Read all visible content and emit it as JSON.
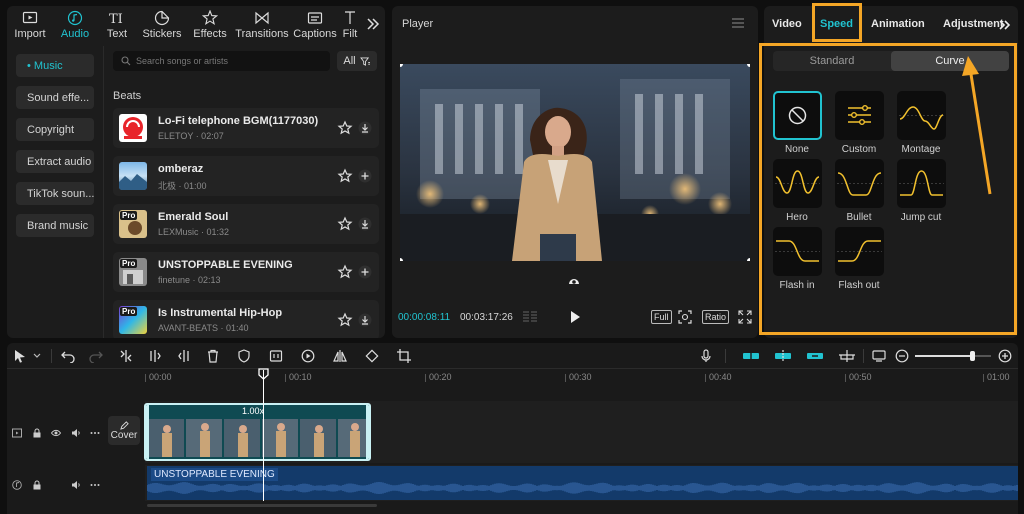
{
  "media_tabs": [
    {
      "label": "Import",
      "icon": "import-icon"
    },
    {
      "label": "Audio",
      "icon": "audio-icon",
      "active": true
    },
    {
      "label": "Text",
      "icon": "text-icon"
    },
    {
      "label": "Stickers",
      "icon": "stickers-icon"
    },
    {
      "label": "Effects",
      "icon": "effects-icon"
    },
    {
      "label": "Transitions",
      "icon": "transitions-icon"
    },
    {
      "label": "Captions",
      "icon": "captions-icon"
    },
    {
      "label": "Filt",
      "icon": "filters-icon"
    }
  ],
  "audio_sidebar": [
    {
      "label": "• Music",
      "active": true
    },
    {
      "label": "Sound effe..."
    },
    {
      "label": "Copyright"
    },
    {
      "label": "Extract audio"
    },
    {
      "label": "TikTok soun..."
    },
    {
      "label": "Brand music"
    }
  ],
  "search": {
    "placeholder": "Search songs or artists"
  },
  "filter_button": "All",
  "section_title": "Beats",
  "tracks": [
    {
      "title": "Lo-Fi telephone BGM(1177030)",
      "meta": "ELETOY · 02:07",
      "action": "download"
    },
    {
      "title": "omberaz",
      "meta": "北极 · 01:00",
      "action": "add"
    },
    {
      "title": "Emerald Soul",
      "meta": "LEXMusic · 01:32",
      "action": "download"
    },
    {
      "title": "UNSTOPPABLE EVENING",
      "meta": "finetune · 02:13",
      "action": "add"
    },
    {
      "title": "Is Instrumental Hip-Hop",
      "meta": "AVANT-BEATS · 01:40",
      "action": "download"
    }
  ],
  "thumb_badge": "Pro",
  "player": {
    "title": "Player",
    "current_time": "00:00:08:11",
    "total_time": "00:03:17:26",
    "full_label": "Full",
    "ratio_label": "Ratio"
  },
  "inspector_tabs": [
    {
      "label": "Video"
    },
    {
      "label": "Speed",
      "active": true
    },
    {
      "label": "Animation"
    },
    {
      "label": "Adjustment"
    }
  ],
  "speed_modes": {
    "standard": "Standard",
    "curve": "Curve",
    "selected": "Curve"
  },
  "curve_presets": [
    {
      "label": "None",
      "selected": true
    },
    {
      "label": "Custom"
    },
    {
      "label": "Montage"
    },
    {
      "label": "Hero"
    },
    {
      "label": "Bullet"
    },
    {
      "label": "Jump cut"
    },
    {
      "label": "Flash in"
    },
    {
      "label": "Flash out"
    }
  ],
  "timeline": {
    "ruler": [
      "00:00",
      "00:10",
      "00:20",
      "00:30",
      "00:40",
      "00:50",
      "01:00"
    ],
    "clip_speed": "1.00x",
    "cover_label": "Cover",
    "audio_clip_label": "UNSTOPPABLE EVENING",
    "zoom_level": 0.75
  },
  "colors": {
    "accent": "#21c3d0",
    "highlight": "#f4a626",
    "curve": "#f2c12e"
  }
}
